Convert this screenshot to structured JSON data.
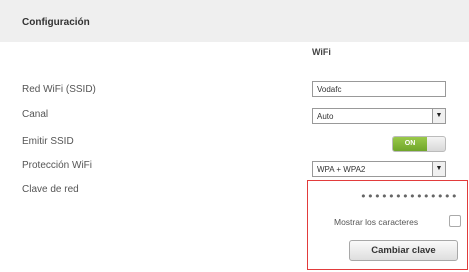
{
  "header": {
    "title": "Configuración"
  },
  "wifi": {
    "column_title": "WiFi",
    "ssid": {
      "label": "Red WiFi (SSID)",
      "value": "Vodafc"
    },
    "channel": {
      "label": "Canal",
      "value": "Auto"
    },
    "broadcast": {
      "label": "Emitir SSID",
      "toggle_text": "ON"
    },
    "protection": {
      "label": "Protección WiFi",
      "value": "WPA + WPA2"
    },
    "key": {
      "label": "Clave de red",
      "masked_value": "••••••••••••••",
      "show_chars_label": "Mostrar los caracteres",
      "change_button": "Cambiar clave"
    }
  },
  "colors": {
    "highlight_border": "#e23b3b",
    "toggle_on": "#7ab531",
    "header_bg": "#efefef"
  }
}
